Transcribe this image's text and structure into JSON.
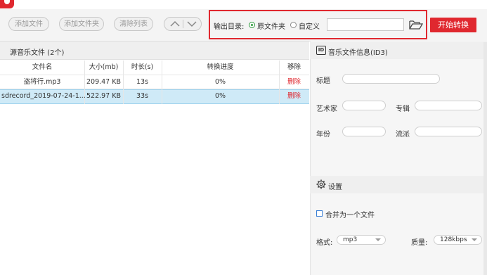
{
  "toolbar": {
    "add_file": "添加文件",
    "add_folder": "添加文件夹",
    "clear_list": "清除列表",
    "output_dir_label": "输出目录:",
    "option_source": "原文件夹",
    "option_custom": "自定义",
    "start_label": "开始转换",
    "path_value": ""
  },
  "source": {
    "title": "源音乐文件 (2个)",
    "columns": [
      "文件名",
      "大小(mb)",
      "时长(s)",
      "转换进度",
      "移除"
    ],
    "rows": [
      {
        "name": "盗将行.mp3",
        "size": "209.47 KB",
        "duration": "13s",
        "progress": "0%",
        "remove": "删除"
      },
      {
        "name": "sdrecord_2019-07-24-1...",
        "size": "522.97 KB",
        "duration": "33s",
        "progress": "0%",
        "remove": "删除"
      }
    ]
  },
  "id3": {
    "title": "音乐文件信息(ID3)",
    "icon_text": "ID",
    "title_label": "标题",
    "artist_label": "艺术家",
    "album_label": "专辑",
    "year_label": "年份",
    "genre_label": "流派"
  },
  "settings": {
    "title": "设置",
    "merge_label": "合并为一个文件",
    "format_label": "格式:",
    "format_value": "mp3",
    "quality_label": "质量:",
    "quality_value": "128kbps"
  },
  "colors": {
    "accent": "#e0282f",
    "selected_row": "#cfeaf7"
  }
}
